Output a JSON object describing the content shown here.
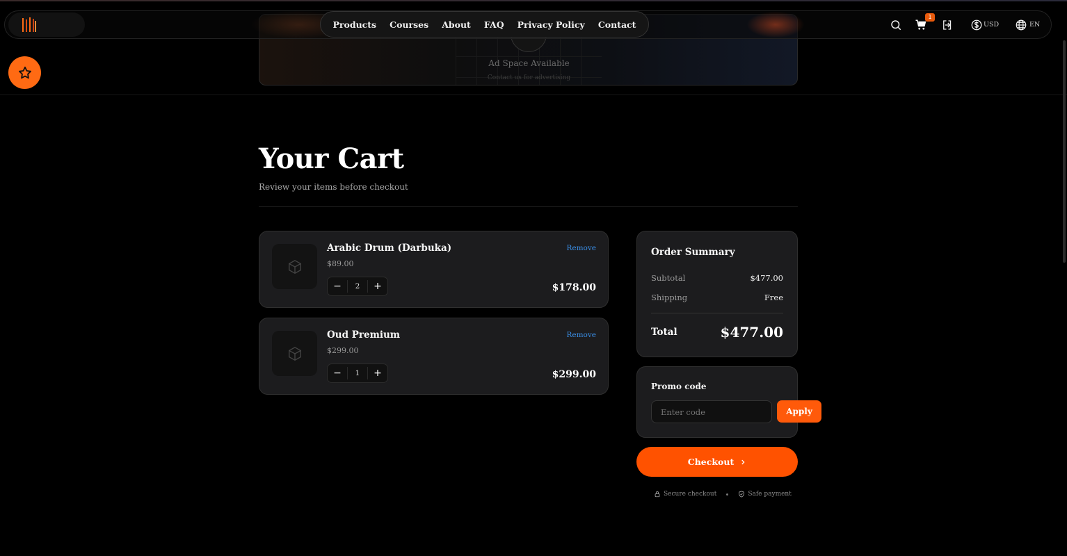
{
  "ad": {
    "title": "Ad Space Available",
    "subtitle": "Contact us for advertising"
  },
  "nav": {
    "items": [
      {
        "label": "Products"
      },
      {
        "label": "Courses"
      },
      {
        "label": "About"
      },
      {
        "label": "FAQ"
      },
      {
        "label": "Privacy Policy"
      },
      {
        "label": "Contact"
      }
    ]
  },
  "header": {
    "cart_count": "1",
    "currency": "USD",
    "language": "EN"
  },
  "page": {
    "title": "Your Cart",
    "subtitle": "Review your items before checkout"
  },
  "cart": {
    "remove_label": "Remove",
    "items": [
      {
        "name": "Arabic Drum (Darbuka)",
        "unit_price": "$89.00",
        "quantity": "2",
        "line_total": "$178.00"
      },
      {
        "name": "Oud Premium",
        "unit_price": "$299.00",
        "quantity": "1",
        "line_total": "$299.00"
      }
    ]
  },
  "summary": {
    "title": "Order Summary",
    "subtotal_label": "Subtotal",
    "subtotal_value": "$477.00",
    "shipping_label": "Shipping",
    "shipping_value": "Free",
    "total_label": "Total",
    "total_value": "$477.00"
  },
  "promo": {
    "label": "Promo code",
    "placeholder": "Enter code",
    "apply_label": "Apply"
  },
  "checkout": {
    "label": "Checkout",
    "secure_label": "Secure checkout",
    "safe_label": "Safe payment"
  },
  "colors": {
    "accent": "#ff5200",
    "link": "#3a8ee6",
    "card": "#1c1c1e"
  }
}
